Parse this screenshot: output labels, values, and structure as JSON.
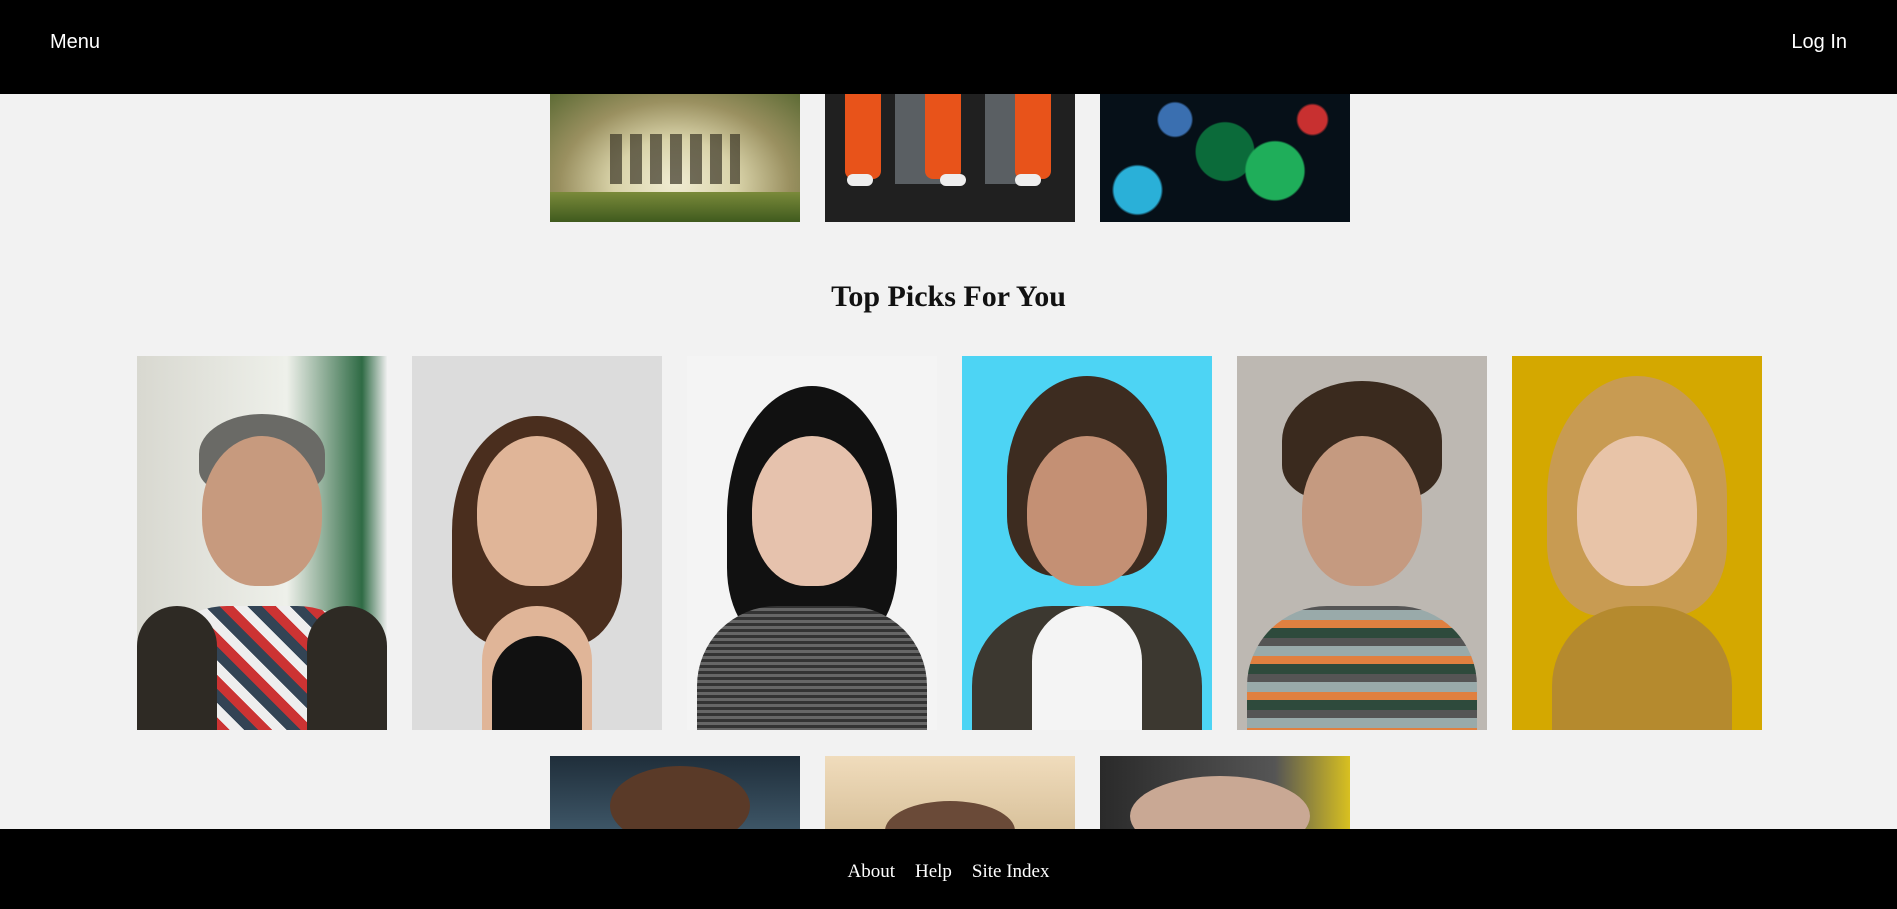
{
  "header": {
    "menu_label": "Menu",
    "login_label": "Log In"
  },
  "top_picks": {
    "title": "Top Picks For You"
  },
  "footer": {
    "links": [
      "About",
      "Help",
      "Site Index"
    ]
  }
}
